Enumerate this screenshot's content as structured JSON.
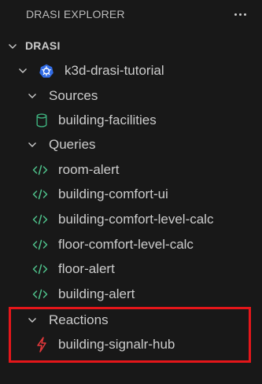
{
  "header": {
    "title": "DRASI EXPLORER",
    "more_icon": "ellipsis-icon"
  },
  "tree": {
    "root_label": "DRASI",
    "context": {
      "label": "k3d-drasi-tutorial",
      "icon": "kubernetes-icon"
    },
    "sources": {
      "label": "Sources",
      "items": [
        {
          "label": "building-facilities",
          "icon": "database-icon"
        }
      ]
    },
    "queries": {
      "label": "Queries",
      "items": [
        {
          "label": "room-alert",
          "icon": "code-icon"
        },
        {
          "label": "building-comfort-ui",
          "icon": "code-icon"
        },
        {
          "label": "building-comfort-level-calc",
          "icon": "code-icon"
        },
        {
          "label": "floor-comfort-level-calc",
          "icon": "code-icon"
        },
        {
          "label": "floor-alert",
          "icon": "code-icon"
        },
        {
          "label": "building-alert",
          "icon": "code-icon"
        }
      ]
    },
    "reactions": {
      "label": "Reactions",
      "items": [
        {
          "label": "building-signalr-hub",
          "icon": "lightning-icon"
        }
      ]
    }
  },
  "colors": {
    "background": "#181818",
    "text": "#cccccc",
    "code_icon": "#4ec08a",
    "database_icon": "#3fb27f",
    "kubernetes_icon": "#326ce5",
    "lightning_icon": "#e5383b",
    "highlight": "#e4161a"
  }
}
